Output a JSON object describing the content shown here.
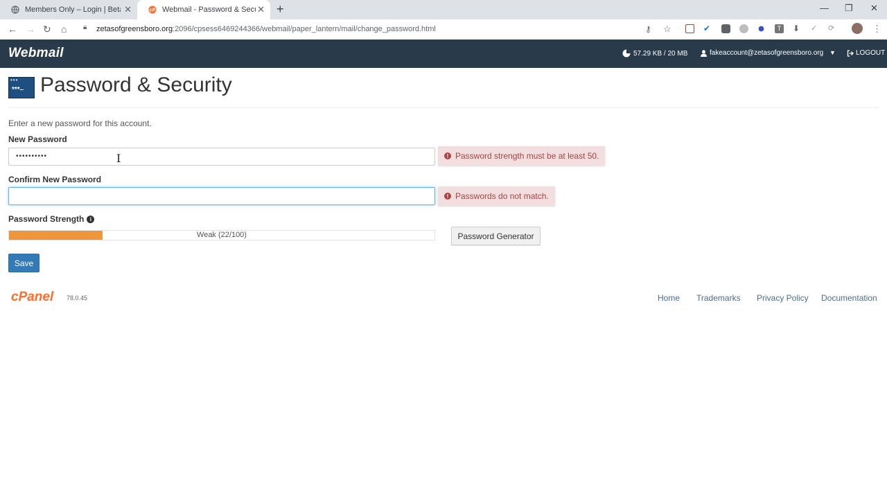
{
  "browser": {
    "tabs": [
      {
        "title": "Members Only – Login | Beta Nu",
        "active": false
      },
      {
        "title": "Webmail - Password & Security",
        "active": true
      }
    ],
    "url_host": "zetasofgreensboro.org",
    "url_path": ":2096/cpsess6469244366/webmail/paper_lantern/mail/change_password.html",
    "new_tab_icon": "+",
    "window_controls": [
      "minimize-icon",
      "maximize-icon",
      "close-icon"
    ]
  },
  "header": {
    "app_name": "Webmail",
    "quota": "57.29 KB / 20 MB",
    "account": "fakeaccount@zetasofgreensboro.org",
    "logout": "LOGOUT"
  },
  "page": {
    "title": "Password & Security",
    "intro": "Enter a new password for this account.",
    "new_password_label": "New Password",
    "new_password_value": "••••••••••",
    "new_password_error": "Password strength must be at least 50.",
    "confirm_password_label": "Confirm New Password",
    "confirm_password_value": "",
    "confirm_password_error": "Passwords do not match.",
    "strength_label": "Password Strength",
    "strength_text": "Weak (22/100)",
    "strength_value": 22,
    "generator_button": "Password Generator",
    "save_button": "Save"
  },
  "footer": {
    "brand": "cPanel",
    "version": "78.0.45",
    "links": [
      "Home",
      "Trademarks",
      "Privacy Policy",
      "Documentation"
    ]
  },
  "colors": {
    "header_bg": "#293a4a",
    "strength_fill": "#f0963a",
    "error_bg": "#f2dede",
    "save_button": "#337ab7"
  }
}
